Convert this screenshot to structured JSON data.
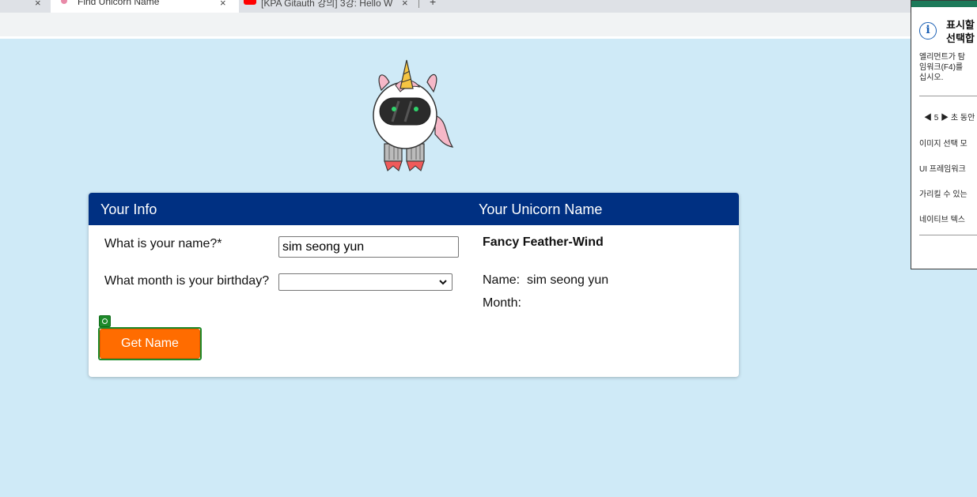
{
  "browser": {
    "tabs": [
      {
        "title": "Find Unicorn Name",
        "active": true
      },
      {
        "title": "[KPA Gitauth 강의] 3강: Hello W",
        "active": false
      }
    ]
  },
  "card": {
    "left_header": "Your Info",
    "right_header": "Your Unicorn Name",
    "name_label": "What is your name?*",
    "name_value": "sim seong yun",
    "birthday_label": "What month is your birthday?",
    "birthday_value": "",
    "button_label": "Get Name",
    "result_name": "Fancy Feather-Wind",
    "name_prefix": "Name:",
    "name_result": "sim seong yun",
    "month_prefix": "Month:"
  },
  "panel": {
    "heading_line1": "표시할",
    "heading_line2": "선택합",
    "desc_line1": "엘리먼트가 탐",
    "desc_line2": "임워크(F4)를",
    "desc_line3": "십시오.",
    "item_delay": "◀ 5 ▶ 초 동안",
    "item_image": "이미지 선택 모",
    "item_ui": "UI 프레임워크",
    "item_point": "가리킬 수 있는",
    "item_native": "네이티브 텍스"
  },
  "colors": {
    "background": "#cfeaf7",
    "header": "#003082",
    "button": "#ff6c00",
    "highlight": "#1e8a2a"
  }
}
